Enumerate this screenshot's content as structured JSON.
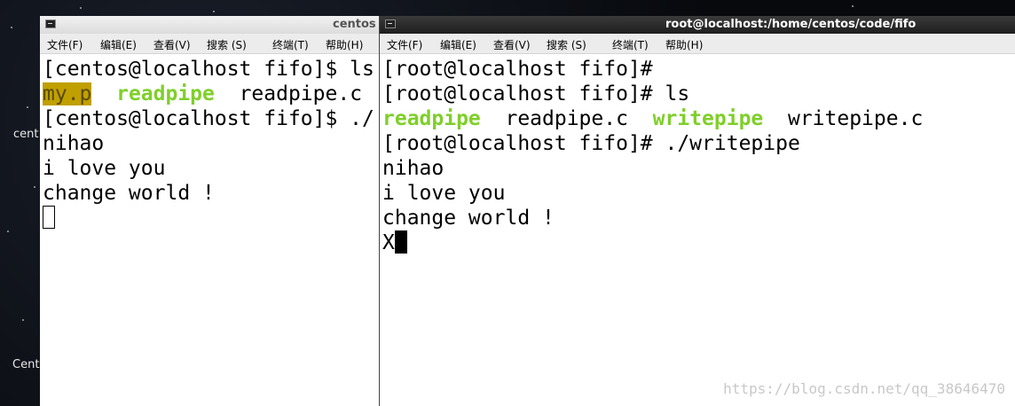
{
  "desktop": {
    "icon_label_1": "cent",
    "icon_label_2": "Cent"
  },
  "left_window": {
    "title": "centos",
    "menu": [
      "文件(F)",
      "编辑(E)",
      "查看(V)",
      "搜索 (S)",
      "终端(T)",
      "帮助(H)"
    ],
    "lines": {
      "l1": "[centos@localhost fifo]$ ls",
      "l2_hl": "my.p",
      "l2_green": "readpipe",
      "l2_rest": "  readpipe.c",
      "l3": "[centos@localhost fifo]$ ./",
      "l4": "nihao",
      "l5": "i love you",
      "l6": "change world !"
    }
  },
  "right_window": {
    "title": "root@localhost:/home/centos/code/fifo",
    "menu": [
      "文件(F)",
      "编辑(E)",
      "查看(V)",
      "搜索 (S)",
      "终端(T)",
      "帮助(H)"
    ],
    "lines": {
      "l1": "[root@localhost fifo]#",
      "l2": "[root@localhost fifo]# ls",
      "l3_g1": "readpipe",
      "l3_t1": "  readpipe.c  ",
      "l3_g2": "writepipe",
      "l3_t2": "  writepipe.c",
      "l4": "[root@localhost fifo]# ./writepipe",
      "l5": "nihao",
      "l6": "i love you",
      "l7": "change world !",
      "l8": "X"
    }
  },
  "watermark": "https://blog.csdn.net/qq_38646470"
}
